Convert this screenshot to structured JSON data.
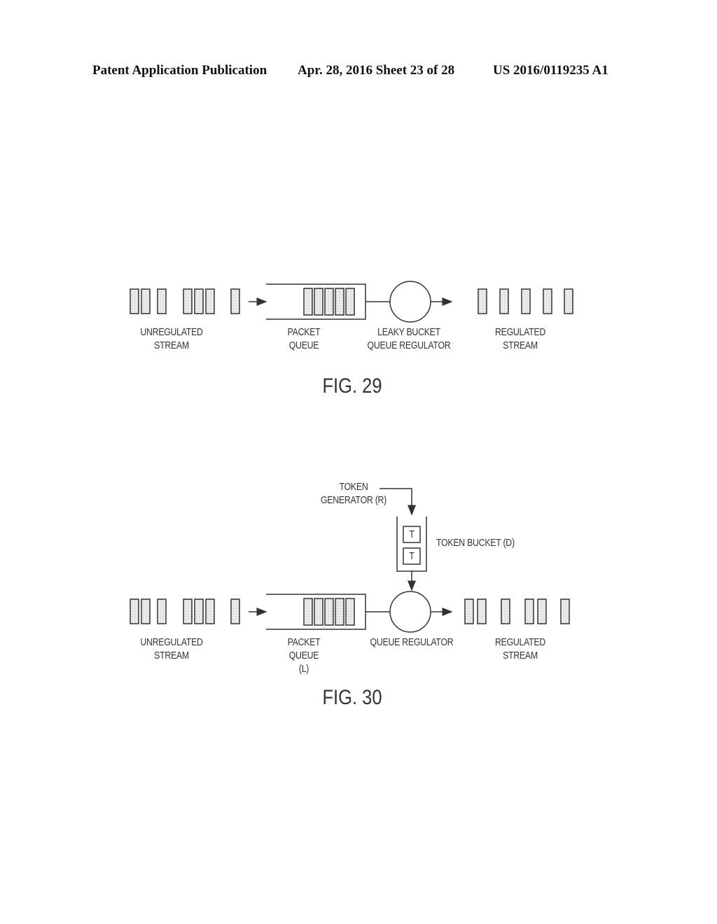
{
  "header": {
    "publication": "Patent Application Publication",
    "date_sheet": "Apr. 28, 2016  Sheet 23 of 28",
    "patent_number": "US 2016/0119235 A1"
  },
  "fig29": {
    "caption": "FIG. 29",
    "labels": {
      "unregulated": [
        "UNREGULATED",
        "STREAM"
      ],
      "queue": [
        "PACKET",
        "QUEUE"
      ],
      "regulator": [
        "LEAKY BUCKET",
        "QUEUE REGULATOR"
      ],
      "regulated": [
        "REGULATED",
        "STREAM"
      ]
    },
    "unregulated_packet_groups": [
      3,
      3,
      1
    ],
    "queued_packets": 5,
    "regulated_packets": 5
  },
  "fig30": {
    "caption": "FIG. 30",
    "labels": {
      "unregulated": [
        "UNREGULATED",
        "STREAM"
      ],
      "queue": [
        "PACKET",
        "QUEUE",
        "(L)"
      ],
      "regulator": [
        "QUEUE REGULATOR"
      ],
      "regulated": [
        "REGULATED",
        "STREAM"
      ],
      "token_generator": [
        "TOKEN",
        "GENERATOR (R)"
      ],
      "token_bucket": "TOKEN BUCKET (D)"
    },
    "token_symbol": "T",
    "tokens_in_bucket": 2,
    "unregulated_packet_groups": [
      3,
      3,
      1
    ],
    "queued_packets": 5,
    "regulated_packets": 6
  }
}
